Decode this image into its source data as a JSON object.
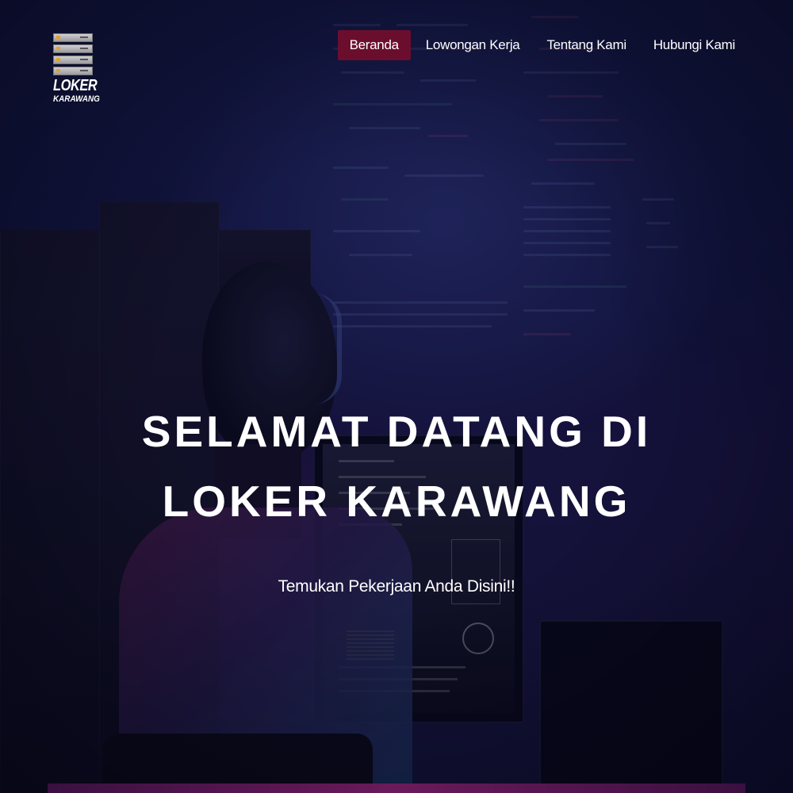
{
  "logo": {
    "line1": "LOKER",
    "line2": "KARAWANG"
  },
  "nav": {
    "items": [
      {
        "label": "Beranda",
        "active": true
      },
      {
        "label": "Lowongan Kerja",
        "active": false
      },
      {
        "label": "Tentang Kami",
        "active": false
      },
      {
        "label": "Hubungi Kami",
        "active": false
      }
    ]
  },
  "hero": {
    "title_line1": "SELAMAT DATANG DI",
    "title_line2": "LOKER KARAWANG",
    "subtitle": "Temukan Pekerjaan Anda Disini!!"
  },
  "colors": {
    "active_nav_bg": "#6b0e2e",
    "background": "#141746",
    "text": "#ffffff"
  }
}
